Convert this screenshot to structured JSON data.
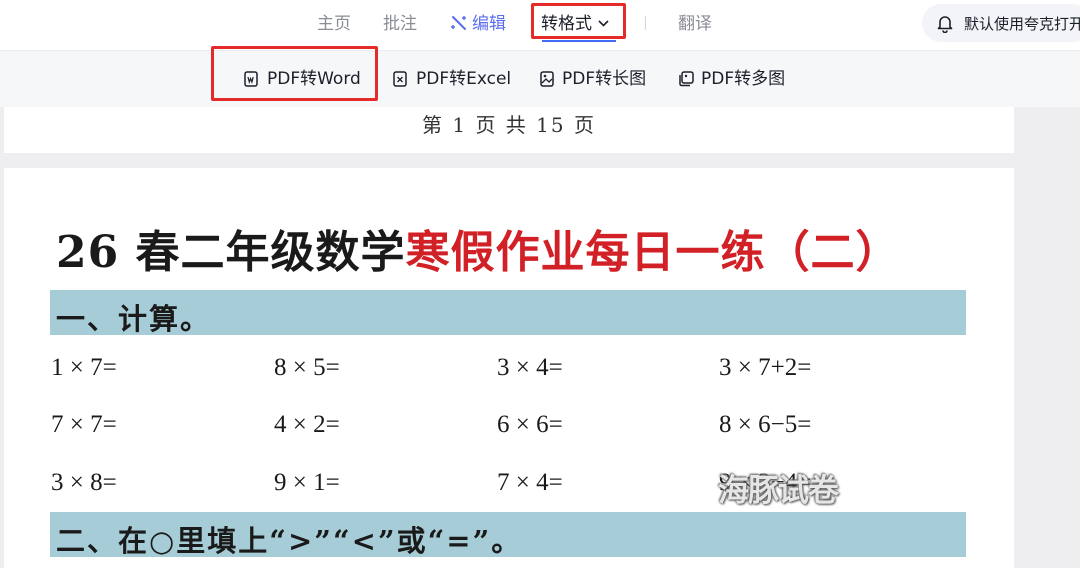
{
  "topnav": {
    "home": "主页",
    "annotate": "批注",
    "edit": "编辑",
    "convert": "转格式",
    "translate": "翻译",
    "default_open": "默认使用夸克打开"
  },
  "toolbar": {
    "pdf_to_word": "PDF转Word",
    "pdf_to_excel": "PDF转Excel",
    "pdf_to_long_image": "PDF转长图",
    "pdf_to_multi_image": "PDF转多图"
  },
  "page_counter": "第 1 页  共 15 页",
  "document": {
    "title_black": "26 春二年级数学",
    "title_red": "寒假作业每日一练（二）",
    "section1": "一、计算。",
    "problems": [
      [
        "1 × 7=",
        "8 × 5=",
        "3 × 4=",
        "3 × 7+2="
      ],
      [
        "7 × 7=",
        "4 × 2=",
        "6 × 6=",
        "8 × 6−5="
      ],
      [
        "3 × 8=",
        "9 × 1=",
        "7 × 4=",
        "9 × 3−4="
      ]
    ],
    "watermark": "海豚试卷",
    "section2": "二、在○里填上“>”“<”或“=”。"
  },
  "colors": {
    "accent": "#3f6bf5",
    "highlight": "#e52a2a",
    "title_red": "#d22027",
    "section_bar": "#a6cdd7"
  },
  "icons": [
    "magic-wand-icon",
    "chevron-down-icon",
    "bell-icon",
    "word-doc-icon",
    "excel-doc-icon",
    "long-image-icon",
    "multi-image-icon"
  ]
}
